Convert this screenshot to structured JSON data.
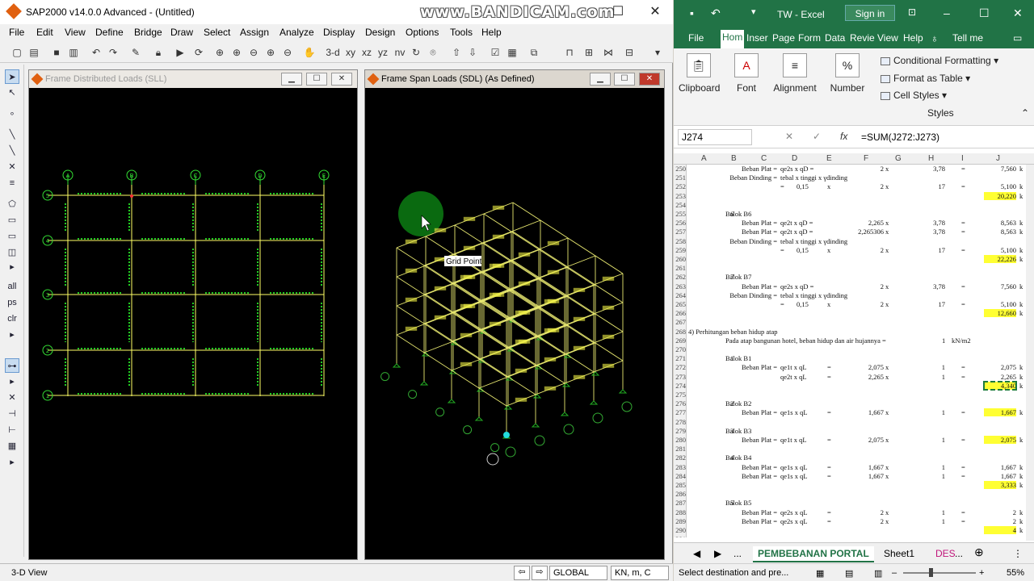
{
  "sap": {
    "title": "SAP2000 v14.0.0 Advanced  - (Untitled)",
    "watermark": "www.BANDICAM.com",
    "menu": [
      "File",
      "Edit",
      "View",
      "Define",
      "Bridge",
      "Draw",
      "Select",
      "Assign",
      "Analyze",
      "Display",
      "Design",
      "Options",
      "Tools",
      "Help"
    ],
    "toolbar": {
      "view3d": "3-d",
      "xy": "xy",
      "xz": "xz",
      "yz": "yz",
      "nv": "nv"
    },
    "left_pane": {
      "title": "Frame Distributed Loads (SLL)",
      "grid_cols": [
        "A",
        "B",
        "C",
        "D",
        "E"
      ],
      "grid_rows": [
        "5",
        "4",
        "3",
        "2",
        "1"
      ]
    },
    "right_pane": {
      "title": "Frame Span Loads (SDL) (As Defined)",
      "tooltip": "Grid Point"
    },
    "status": {
      "view": "3-D View",
      "coord": "GLOBAL",
      "units": "KN, m, C"
    }
  },
  "excel": {
    "title": "TW  -  Excel",
    "signin": "Sign in",
    "tabs": [
      "File",
      "Hom",
      "Inser",
      "Page",
      "Form",
      "Data",
      "Revie",
      "View",
      "Help",
      "Tell me"
    ],
    "ribbon": {
      "clipboard": "Clipboard",
      "font": "Font",
      "alignment": "Alignment",
      "number": "Number",
      "cond_format": "Conditional Formatting",
      "format_table": "Format as Table",
      "cell_styles": "Cell Styles",
      "styles": "Styles"
    },
    "name_box": "J274",
    "formula": "=SUM(J272:J273)",
    "columns": [
      "A",
      "B",
      "C",
      "D",
      "E",
      "F",
      "G",
      "H",
      "I",
      "J"
    ],
    "rows": [
      {
        "n": "250",
        "B": "Beban Plat =",
        "C": "qe2s x qD =",
        "F": "2",
        "G": "x",
        "H": "3,78",
        "I": "=",
        "J": "7,560"
      },
      {
        "n": "251",
        "B": "Beban Dinding =",
        "C": "tebal x tinggi x γdinding"
      },
      {
        "n": "252",
        "C": "=",
        "D": "0,15",
        "E": "x",
        "F": "2",
        "G": "x",
        "H": "17",
        "I": "=",
        "J": "5,100"
      },
      {
        "n": "253",
        "J": "20,220",
        "hl": true
      },
      {
        "n": "254"
      },
      {
        "n": "255",
        "A2": "6",
        "B": "Balok B6"
      },
      {
        "n": "256",
        "B": "Beban Plat =",
        "C": "qe2t x qD =",
        "F": "2,265",
        "G": "x",
        "H": "3,78",
        "I": "=",
        "J": "8,563"
      },
      {
        "n": "257",
        "B": "Beban Plat =",
        "C": "qe2t x qD =",
        "F": "2,265306",
        "G": "x",
        "H": "3,78",
        "I": "=",
        "J": "8,563"
      },
      {
        "n": "258",
        "B": "Beban Dinding =",
        "C": "tebal x tinggi x γdinding"
      },
      {
        "n": "259",
        "C": "=",
        "D": "0,15",
        "E": "x",
        "F": "2",
        "G": "x",
        "H": "17",
        "I": "=",
        "J": "5,100"
      },
      {
        "n": "260",
        "J": "22,226",
        "hl": true
      },
      {
        "n": "261"
      },
      {
        "n": "262",
        "A2": "7",
        "B": "Balok B7"
      },
      {
        "n": "263",
        "B": "Beban Plat =",
        "C": "qe2s x qD =",
        "F": "2",
        "G": "x",
        "H": "3,78",
        "I": "=",
        "J": "7,560"
      },
      {
        "n": "264",
        "B": "Beban Dinding =",
        "C": "tebal x tinggi x γdinding"
      },
      {
        "n": "265",
        "C": "=",
        "D": "0,15",
        "E": "x",
        "F": "2",
        "G": "x",
        "H": "17",
        "I": "=",
        "J": "5,100"
      },
      {
        "n": "266",
        "J": "12,660",
        "hl": true
      },
      {
        "n": "267"
      },
      {
        "n": "268",
        "A": "4) Perhitungan beban hidup atap"
      },
      {
        "n": "269",
        "B": "Pada atap bangunan hotel, beban hidup dan air hujannya =",
        "H2": "1",
        "I2": "kN/m2"
      },
      {
        "n": "270"
      },
      {
        "n": "271",
        "A2": "1",
        "B": "Balok B1"
      },
      {
        "n": "272",
        "B": "Beban Plat =",
        "C": "qe1t x qL",
        "E": "=",
        "F": "2,075",
        "G": "x",
        "H": "1",
        "I": "=",
        "J": "2,075"
      },
      {
        "n": "273",
        "C": "qe2t x qL",
        "E": "=",
        "F": "2,265",
        "G": "x",
        "H": "1",
        "I": "=",
        "J": "2,265"
      },
      {
        "n": "274",
        "J": "4,340",
        "hl": true
      },
      {
        "n": "275"
      },
      {
        "n": "276",
        "A2": "2",
        "B": "Balok B2"
      },
      {
        "n": "277",
        "B": "Beban Plat =",
        "C": "qe1s x qL",
        "E": "=",
        "F": "1,667",
        "G": "x",
        "H": "1",
        "I": "=",
        "J": "1,667",
        "hl": true
      },
      {
        "n": "278"
      },
      {
        "n": "279",
        "A2": "3",
        "B": "Balok B3"
      },
      {
        "n": "280",
        "B": "Beban Plat =",
        "C": "qe1t x qL",
        "E": "=",
        "F": "2,075",
        "G": "x",
        "H": "1",
        "I": "=",
        "J": "2,075",
        "hl": true
      },
      {
        "n": "281"
      },
      {
        "n": "282",
        "A2": "4",
        "B": "Balok B4"
      },
      {
        "n": "283",
        "B": "Beban Plat =",
        "C": "qe1s x qL",
        "E": "=",
        "F": "1,667",
        "G": "x",
        "H": "1",
        "I": "=",
        "J": "1,667"
      },
      {
        "n": "284",
        "B": "Beban Plat =",
        "C": "qe1s x qL",
        "E": "=",
        "F": "1,667",
        "G": "x",
        "H": "1",
        "I": "=",
        "J": "1,667"
      },
      {
        "n": "285",
        "J": "3,333",
        "hl": true
      },
      {
        "n": "286"
      },
      {
        "n": "287",
        "A2": "5",
        "B": "Balok B5"
      },
      {
        "n": "288",
        "B": "Beban Plat =",
        "C": "qe2s x qL",
        "E": "=",
        "F": "2",
        "G": "x",
        "H": "1",
        "I": "=",
        "J": "2"
      },
      {
        "n": "289",
        "B": "Beban Plat =",
        "C": "qe2s x qL",
        "E": "=",
        "F": "2",
        "G": "x",
        "H": "1",
        "I": "=",
        "J": "2"
      },
      {
        "n": "290",
        "J": "4",
        "hl": true
      },
      {
        "n": "291"
      }
    ],
    "sheet_tabs": [
      "...",
      "PEMBEBANAN PORTAL",
      "Sheet1",
      "DES",
      "..."
    ],
    "status": "Select destination and pre...",
    "zoom": "55%"
  }
}
